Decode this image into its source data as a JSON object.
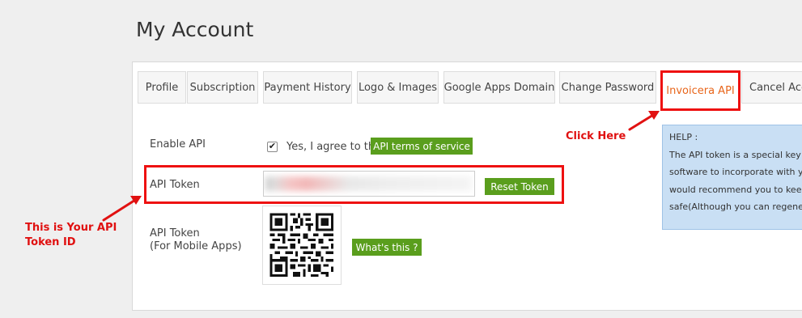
{
  "page": {
    "title": "My Account"
  },
  "tabs": [
    {
      "label": "Profile"
    },
    {
      "label": "Subscription"
    },
    {
      "label": "Payment History"
    },
    {
      "label": "Logo & Images"
    },
    {
      "label": "Google Apps Domain"
    },
    {
      "label": "Change Password"
    },
    {
      "label": "Invoicera API",
      "active": true
    },
    {
      "label": "Cancel Acco"
    }
  ],
  "api": {
    "enable_label": "Enable API",
    "agree_text": "Yes, I agree to the",
    "agree_checked": true,
    "terms_button": "API terms of service",
    "token_label": "API Token",
    "reset_button": "Reset Token",
    "mobile_label_1": "API Token",
    "mobile_label_2": "(For Mobile Apps)",
    "whats_this_button": "What's this ?"
  },
  "help": {
    "title": "HELP :",
    "lines": [
      "The API token is a special key",
      "software to incorporate with yo",
      "would recommend you to keep",
      "safe(Although you can regener"
    ]
  },
  "annotations": {
    "click_here": "Click Here",
    "token_note_1": "This is Your API",
    "token_note_2": "Token ID"
  },
  "colors": {
    "highlight": "#e11111",
    "button_green": "#5a9e1d",
    "active_tab_text": "#e8651a",
    "help_bg": "#c9dff4"
  }
}
